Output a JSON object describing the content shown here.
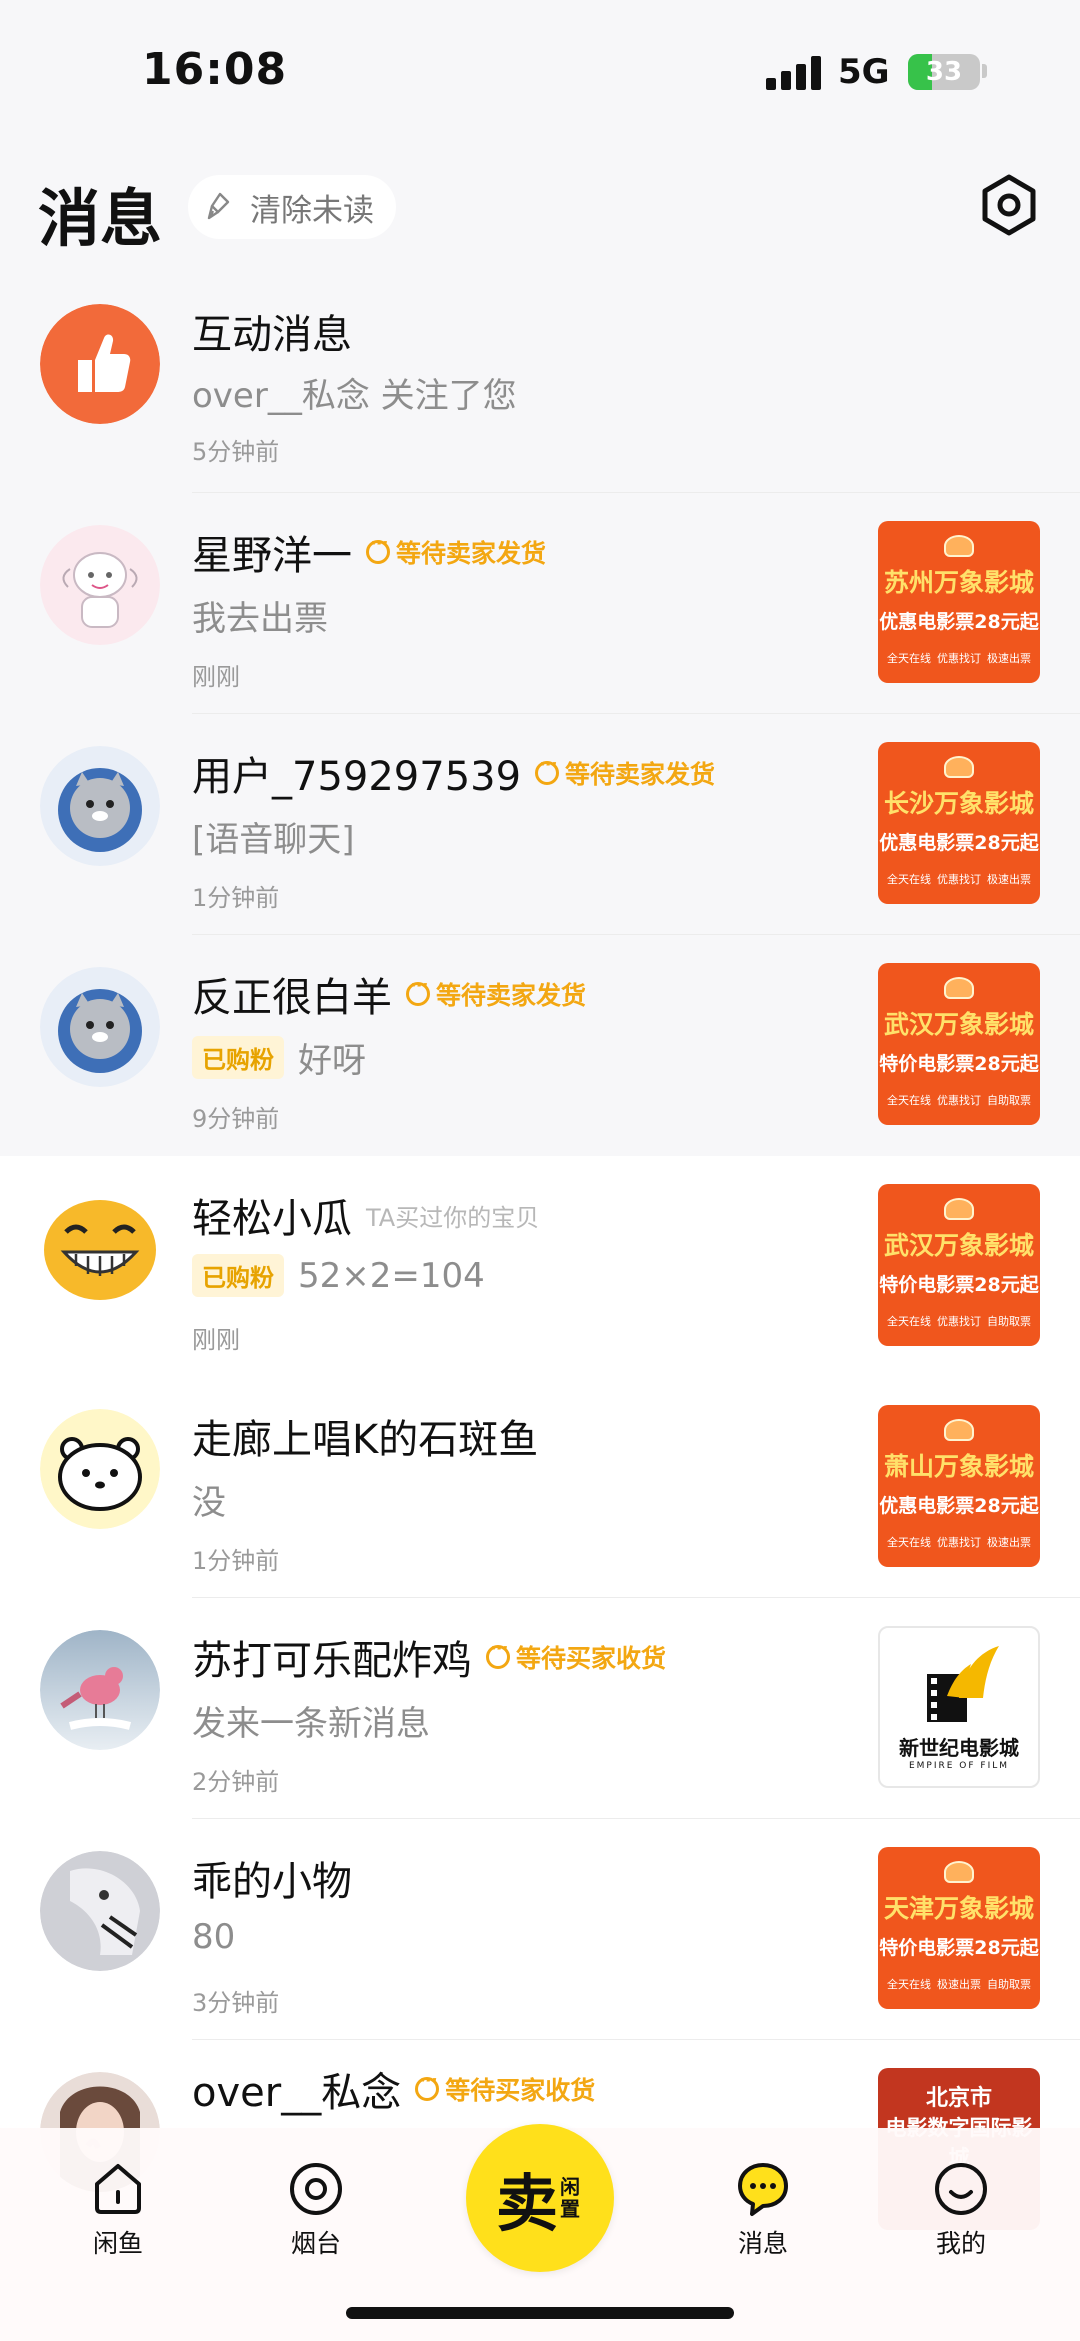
{
  "status_bar": {
    "time": "16:08",
    "network": "5G",
    "battery": "33",
    "battery_level": 0.33
  },
  "header": {
    "title": "消息",
    "clear_unread": "清除未读"
  },
  "colors": {
    "accent_yellow": "#ffe01b",
    "status_orange": "#f3a712",
    "interaction_orange": "#f26a3a",
    "poster_orange": "#f0561d"
  },
  "interaction": {
    "title": "互动消息",
    "message": "over__私念 关注了您",
    "time": "5分钟前",
    "icon": "thumbs-up-icon"
  },
  "conversations": [
    {
      "name": "星野洋一",
      "status": "等待卖家发货",
      "hint": "",
      "badge": "",
      "message": "我去出票",
      "time": "刚刚",
      "poster": {
        "title": "苏州万象影城",
        "subtitle": "优惠电影票28元起",
        "tags": [
          "全天在线",
          "优惠找订",
          "极速出票"
        ]
      }
    },
    {
      "name": "用户_759297539",
      "status": "等待卖家发货",
      "hint": "",
      "badge": "",
      "message": "[语音聊天]",
      "time": "1分钟前",
      "poster": {
        "title": "长沙万象影城",
        "subtitle": "优惠电影票28元起",
        "tags": [
          "全天在线",
          "优惠找订",
          "极速出票"
        ]
      }
    },
    {
      "name": "反正很白羊",
      "status": "等待卖家发货",
      "hint": "",
      "badge": "已购粉",
      "message": "好呀",
      "time": "9分钟前",
      "poster": {
        "title": "武汉万象影城",
        "subtitle": "特价电影票28元起",
        "tags": [
          "全天在线",
          "优惠找订",
          "自助取票"
        ]
      }
    },
    {
      "name": "轻松小瓜",
      "status": "",
      "hint": "TA买过你的宝贝",
      "badge": "已购粉",
      "message": "52×2=104",
      "time": "刚刚",
      "poster": {
        "title": "武汉万象影城",
        "subtitle": "特价电影票28元起",
        "tags": [
          "全天在线",
          "优惠找订",
          "自助取票"
        ]
      }
    },
    {
      "name": "走廊上唱K的石斑鱼",
      "status": "",
      "hint": "",
      "badge": "",
      "message": "没",
      "time": "1分钟前",
      "poster": {
        "title": "萧山万象影城",
        "subtitle": "优惠电影票28元起",
        "tags": [
          "全天在线",
          "优惠找订",
          "极速出票"
        ]
      }
    },
    {
      "name": "苏打可乐配炸鸡",
      "status": "等待买家收货",
      "hint": "",
      "badge": "",
      "message": "发来一条新消息",
      "time": "2分钟前",
      "poster": {
        "title": "新世纪电影城",
        "subtitle": "EMPIRE OF FILM",
        "tags": []
      }
    },
    {
      "name": "乖的小物",
      "status": "",
      "hint": "",
      "badge": "",
      "message": "80",
      "time": "3分钟前",
      "poster": {
        "title": "天津万象影城",
        "subtitle": "特价电影票28元起",
        "tags": [
          "全天在线",
          "极速出票",
          "自助取票"
        ]
      }
    },
    {
      "name": "over__私念",
      "status": "等待买家收货",
      "hint": "",
      "badge": "",
      "message": "",
      "time": "",
      "poster": {
        "title": "北京市",
        "subtitle": "电影数字国际影城",
        "tags": []
      }
    }
  ],
  "tabbar": {
    "tabs": [
      {
        "label": "闲鱼",
        "icon": "home-icon"
      },
      {
        "label": "烟台",
        "icon": "location-icon"
      },
      {
        "label": "消息",
        "icon": "chat-bubble-icon"
      },
      {
        "label": "我的",
        "icon": "profile-face-icon"
      }
    ],
    "sell": {
      "big": "卖",
      "small": "闲置"
    }
  }
}
